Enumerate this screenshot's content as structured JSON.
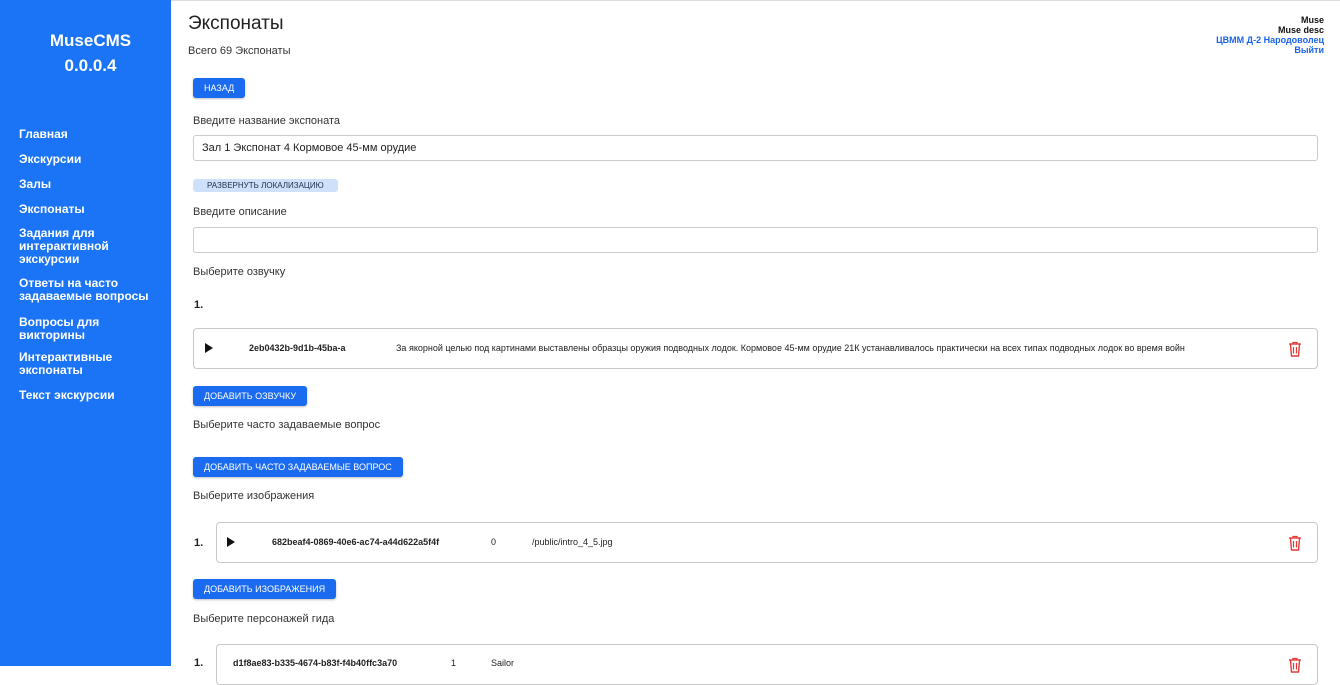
{
  "sidebar": {
    "brand": "MuseCMS",
    "version": "0.0.0.4",
    "items": [
      {
        "label": "Главная"
      },
      {
        "label": "Экскурсии"
      },
      {
        "label": "Залы"
      },
      {
        "label": "Экспонаты"
      },
      {
        "label": "Задания для интерактивной экскурсии"
      },
      {
        "label": "Ответы на часто задаваемые вопросы"
      },
      {
        "label": "Вопросы для викторины"
      },
      {
        "label": "Интерактивные экспонаты"
      },
      {
        "label": "Текст экскурсии"
      }
    ]
  },
  "header": {
    "title": "Экспонаты",
    "subtitle": "Всего 69 Экспонаты"
  },
  "user": {
    "name": "Muse",
    "desc": "Muse desc",
    "org": "ЦВММ Д-2 Народоволец",
    "logout": "Выйти"
  },
  "form": {
    "back_label": "Назад",
    "name_label": "Введите название экспоната",
    "name_value": "Зал 1 Экспонат 4 Кормовое 45-мм орудие",
    "expand_localization_label": "Развернуть локализацию",
    "description_label": "Введите описание",
    "description_value": "",
    "audio_label": "Выберите озвучку",
    "audio_index": "1.",
    "audio_items": [
      {
        "id": "2eb0432b-9d1b-45ba-a",
        "text": "За якорной целью под картинами выставлены образцы оружия подводных лодок. Кормовое 45-мм орудие 21К устанавливалось практически на всех типах подводных лодок во время войн"
      }
    ],
    "add_audio_label": "Добавить озвучку",
    "faq_label": "Выберите часто задаваемые вопрос",
    "add_faq_label": "Добавить часто задаваемые вопрос",
    "images_label": "Выберите изображения",
    "image_items": [
      {
        "index": "1.",
        "id": "682beaf4-0869-40e6-ac74-a44d622a5f4f",
        "order": "0",
        "path": "/public/intro_4_5.jpg"
      }
    ],
    "add_images_label": "Добавить изображения",
    "guide_label": "Выберите персонажей гида",
    "guide_items": [
      {
        "index": "1.",
        "id": "d1f8ae83-b335-4674-b83f-f4b40ffc3a70",
        "order": "1",
        "name": "Sailor"
      }
    ]
  },
  "colors": {
    "sidebar_bg": "#1b74f5",
    "primary_button": "#1b6bf0",
    "light_button": "#cfe0fa",
    "danger_icon": "#e53935"
  }
}
